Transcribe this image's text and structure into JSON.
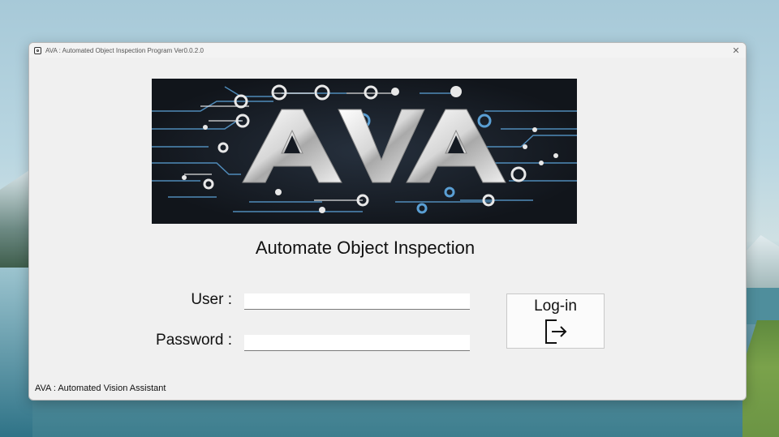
{
  "window": {
    "title": "AVA : Automated Object Inspection Program Ver0.0.2.0",
    "close_symbol": "✕"
  },
  "banner": {
    "logo_text": "AVA",
    "colors": {
      "background": "#151a22",
      "circuit_blue": "#5a9fd4",
      "circuit_white": "#e8e8e8"
    }
  },
  "main": {
    "subtitle": "Automate Object Inspection",
    "user_label": "User :",
    "user_value": "",
    "password_label": "Password :",
    "password_value": "",
    "login_button": {
      "label": "Log-in",
      "icon": "logout-icon"
    }
  },
  "footer": {
    "text": "AVA : Automated Vision Assistant"
  }
}
